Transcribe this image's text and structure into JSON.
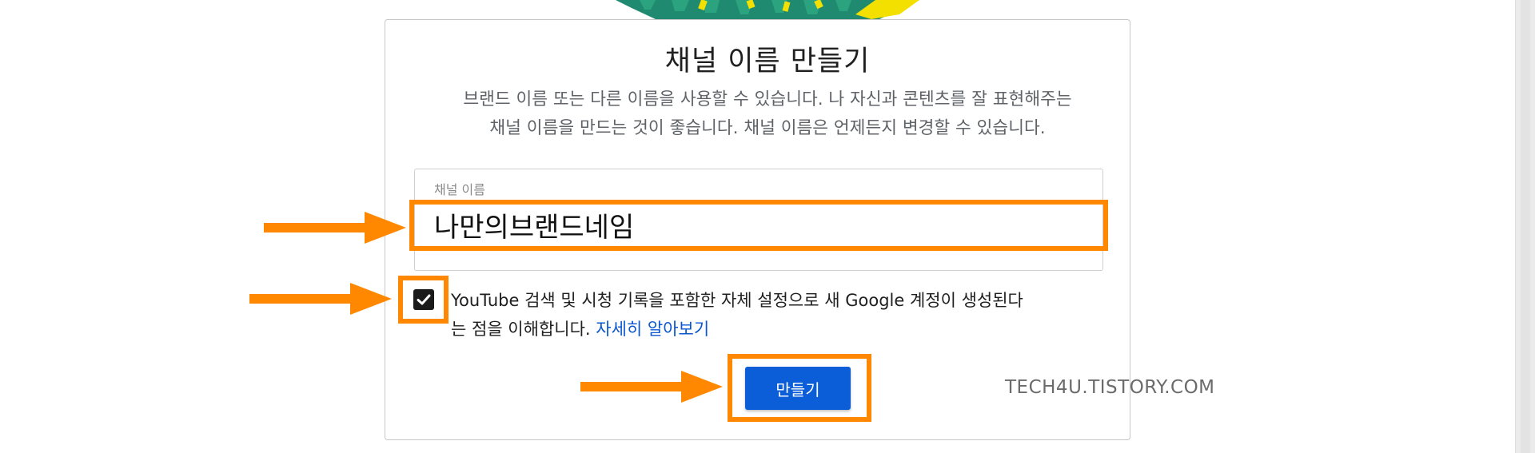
{
  "dialog": {
    "title": "채널 이름 만들기",
    "description_line1": "브랜드 이름 또는 다른 이름을 사용할 수 있습니다. 나 자신과 콘텐츠를 잘 표현해주는",
    "description_line2": "채널 이름을 만드는 것이 좋습니다. 채널 이름은 언제든지 변경할 수 있습니다.",
    "field": {
      "label": "채널 이름",
      "value": "나만의브랜드네임"
    },
    "consent": {
      "checked": true,
      "line1": "YouTube 검색 및 시청 기록을 포함한 자체 설정으로 새 Google 계정이 생성된다",
      "line2_prefix": "는 점을 이해합니다. ",
      "learn_more": "자세히 알아보기"
    },
    "create_button": "만들기"
  },
  "watermark": "TECH4U.TISTORY.COM",
  "colors": {
    "highlight": "#ff8800",
    "button": "#0b5ed7",
    "link": "#0b57d0"
  },
  "icons": [
    "check-icon",
    "right-arrow-icon"
  ]
}
